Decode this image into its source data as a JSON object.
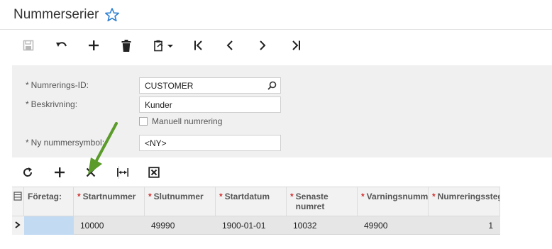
{
  "page": {
    "title": "Nummerserier"
  },
  "toolbar": {
    "icons": [
      "save-icon",
      "undo-icon",
      "add-icon",
      "delete-icon",
      "copy-paste-icon",
      "first-record-icon",
      "previous-record-icon",
      "next-record-icon",
      "last-record-icon"
    ]
  },
  "form": {
    "numbering_id_label": "Numrerings-ID:",
    "numbering_id_value": "CUSTOMER",
    "description_label": "Beskrivning:",
    "description_value": "Kunder",
    "manual_numbering_label": "Manuell numrering",
    "new_symbol_label": "Ny nummersymbol:",
    "new_symbol_value": "<NY>",
    "required_marker": "*"
  },
  "grid_toolbar": {
    "icons": [
      "refresh-icon",
      "add-row-icon",
      "delete-row-icon",
      "fit-columns-icon",
      "export-excel-icon"
    ]
  },
  "grid": {
    "columns": [
      {
        "label": "Företag:",
        "required": false
      },
      {
        "label": "Startnummer",
        "required": true
      },
      {
        "label": "Slutnummer",
        "required": true
      },
      {
        "label": "Startdatum",
        "required": true
      },
      {
        "label": "Senaste numret",
        "required": true
      },
      {
        "label": "Varningsnummer",
        "required": true
      },
      {
        "label": "Numreringssteg",
        "required": true
      }
    ],
    "rows": [
      {
        "cells": [
          "",
          "10000",
          "49990",
          "1900-01-01",
          "10032",
          "49900",
          "1"
        ]
      }
    ]
  },
  "colors": {
    "accent": "#2d7fd3",
    "annotation_arrow": "#5a9b2a",
    "required_star": "#d32f2f",
    "selected_cell": "#c3dbf2"
  }
}
